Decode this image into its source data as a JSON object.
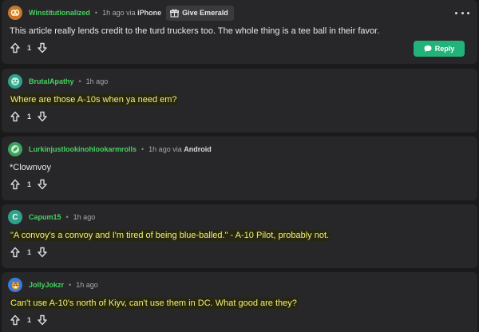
{
  "comments": [
    {
      "author": "Winstitutionalized",
      "time": "1h ago",
      "via_prefix": "via",
      "device": "iPhone",
      "give_label": "Give Emerald",
      "text": "This article really lends credit to the turd truckers too. The whole thing is a tee ball in their favor.",
      "votes": "1",
      "reply_label": "Reply",
      "avatar_icon": "pretzel-icon",
      "avatar_color": "#c8772b"
    },
    {
      "author": "BrutalApathy",
      "time": "1h ago",
      "text": "Where are those A-10s when ya need em?",
      "votes": "1",
      "avatar_icon": "face-avatar-icon",
      "avatar_color": "#2ea38a"
    },
    {
      "author": "Lurkinjustlookinohlookarmrolls",
      "time": "1h ago",
      "via_prefix": "via",
      "device": "Android",
      "text": "*Clownvoy",
      "votes": "1",
      "avatar_icon": "leaf-avatar-icon",
      "avatar_color": "#3aa35d"
    },
    {
      "author": "Capum15",
      "time": "1h ago",
      "avatar_letter": "C",
      "text": "\"A convoy's a convoy and I'm tired of being blue-balled.\" - A-10 Pilot, probably not.",
      "votes": "1",
      "avatar_icon": "letter-avatar-icon",
      "avatar_color": "#2ea38a"
    },
    {
      "author": "JollyJokzr",
      "time": "1h ago",
      "text": "Can't use A-10's north of Kiyv, can't use them in DC. What good are they?",
      "votes": "1",
      "avatar_icon": "tiger-avatar-icon",
      "avatar_color": "#3a7bd5"
    }
  ],
  "separator": "•",
  "colors": {
    "background": "#1a1a1b",
    "card": "#272729",
    "author": "#46d160",
    "reply_button": "#22b37a",
    "highlight_text": "#f4f07a"
  }
}
